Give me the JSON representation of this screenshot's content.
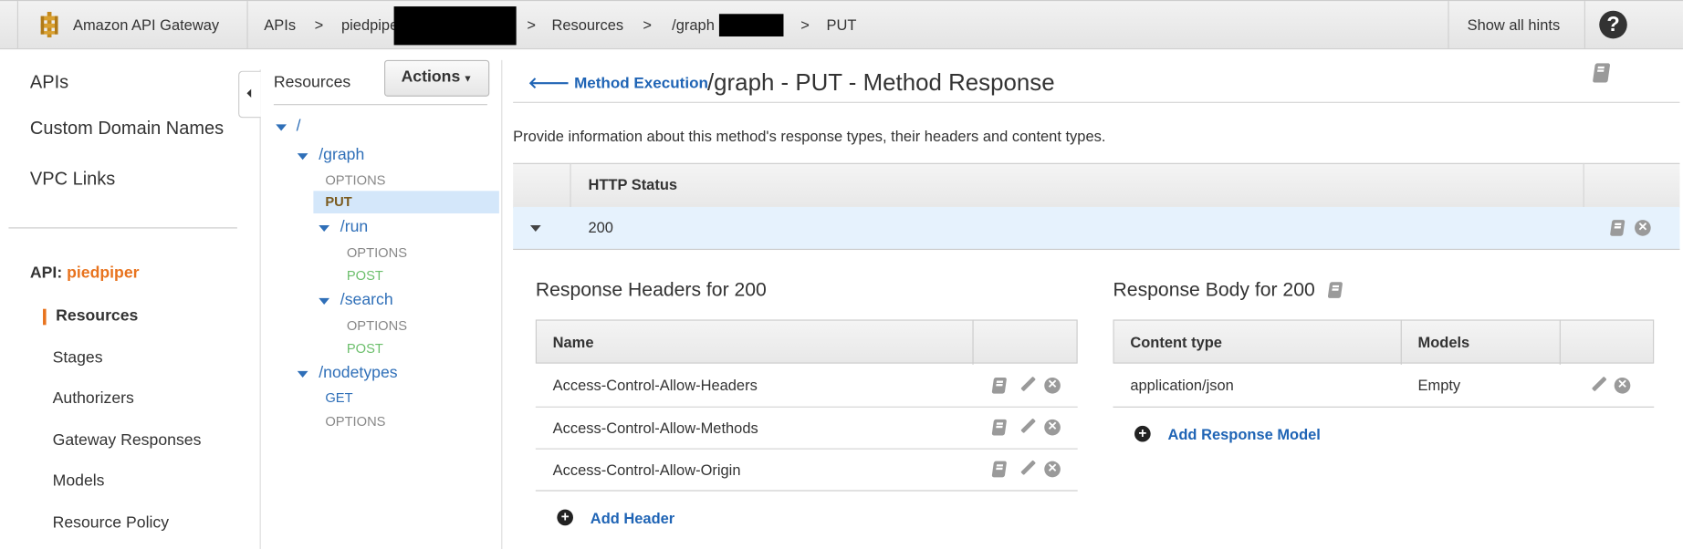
{
  "topbar": {
    "app_title": "Amazon API Gateway",
    "breadcrumb": [
      "APIs",
      "piedpiper",
      "Resources",
      "/graph",
      "PUT"
    ],
    "separator": ">",
    "show_hints": "Show all hints",
    "help_icon": "?"
  },
  "sidebar": {
    "items": [
      "APIs",
      "Custom Domain Names",
      "VPC Links"
    ],
    "api_label": "API:",
    "api_name": "piedpiper",
    "sub_items": [
      "Resources",
      "Stages",
      "Authorizers",
      "Gateway Responses",
      "Models",
      "Resource Policy"
    ]
  },
  "resources": {
    "title": "Resources",
    "actions": "Actions",
    "tree": {
      "root": "/",
      "graph": "/graph",
      "graph_options": "OPTIONS",
      "graph_put": "PUT",
      "run": "/run",
      "run_options": "OPTIONS",
      "run_post": "POST",
      "search": "/search",
      "search_options": "OPTIONS",
      "search_post": "POST",
      "nodetypes": "/nodetypes",
      "nodetypes_get": "GET",
      "nodetypes_options": "OPTIONS"
    }
  },
  "main": {
    "back_link": "Method Execution",
    "title": "/graph - PUT - Method Response",
    "description": "Provide information about this method's response types, their headers and content types.",
    "status_header": "HTTP Status",
    "status_row": "200",
    "headers_title": "Response Headers for 200",
    "headers_col": "Name",
    "headers": [
      "Access-Control-Allow-Headers",
      "Access-Control-Allow-Methods",
      "Access-Control-Allow-Origin"
    ],
    "add_header": "Add Header",
    "body_title": "Response Body for 200",
    "body_cols": [
      "Content type",
      "Models"
    ],
    "body_rows": [
      {
        "content_type": "application/json",
        "model": "Empty"
      }
    ],
    "add_model": "Add Response Model"
  },
  "colors": {
    "accent": "#1f64b5",
    "api_name": "#e8731e",
    "selected": "#d4e7fa",
    "row": "#e6f2fd"
  }
}
